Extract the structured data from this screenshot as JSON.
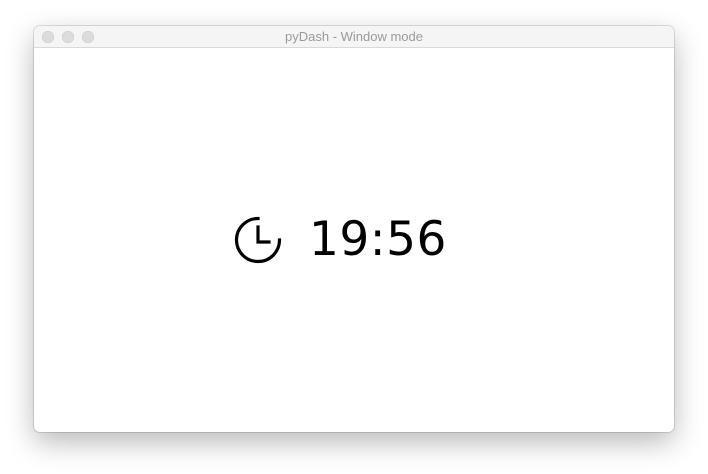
{
  "window": {
    "title": "pyDash - Window mode"
  },
  "clock": {
    "icon": "clock-icon",
    "time": "19:56"
  },
  "colors": {
    "titlebar_bg": "#f5f5f5",
    "title_text": "#9a9a9a",
    "traffic_light": "#dcdcdc",
    "foreground": "#000000",
    "background": "#ffffff"
  }
}
